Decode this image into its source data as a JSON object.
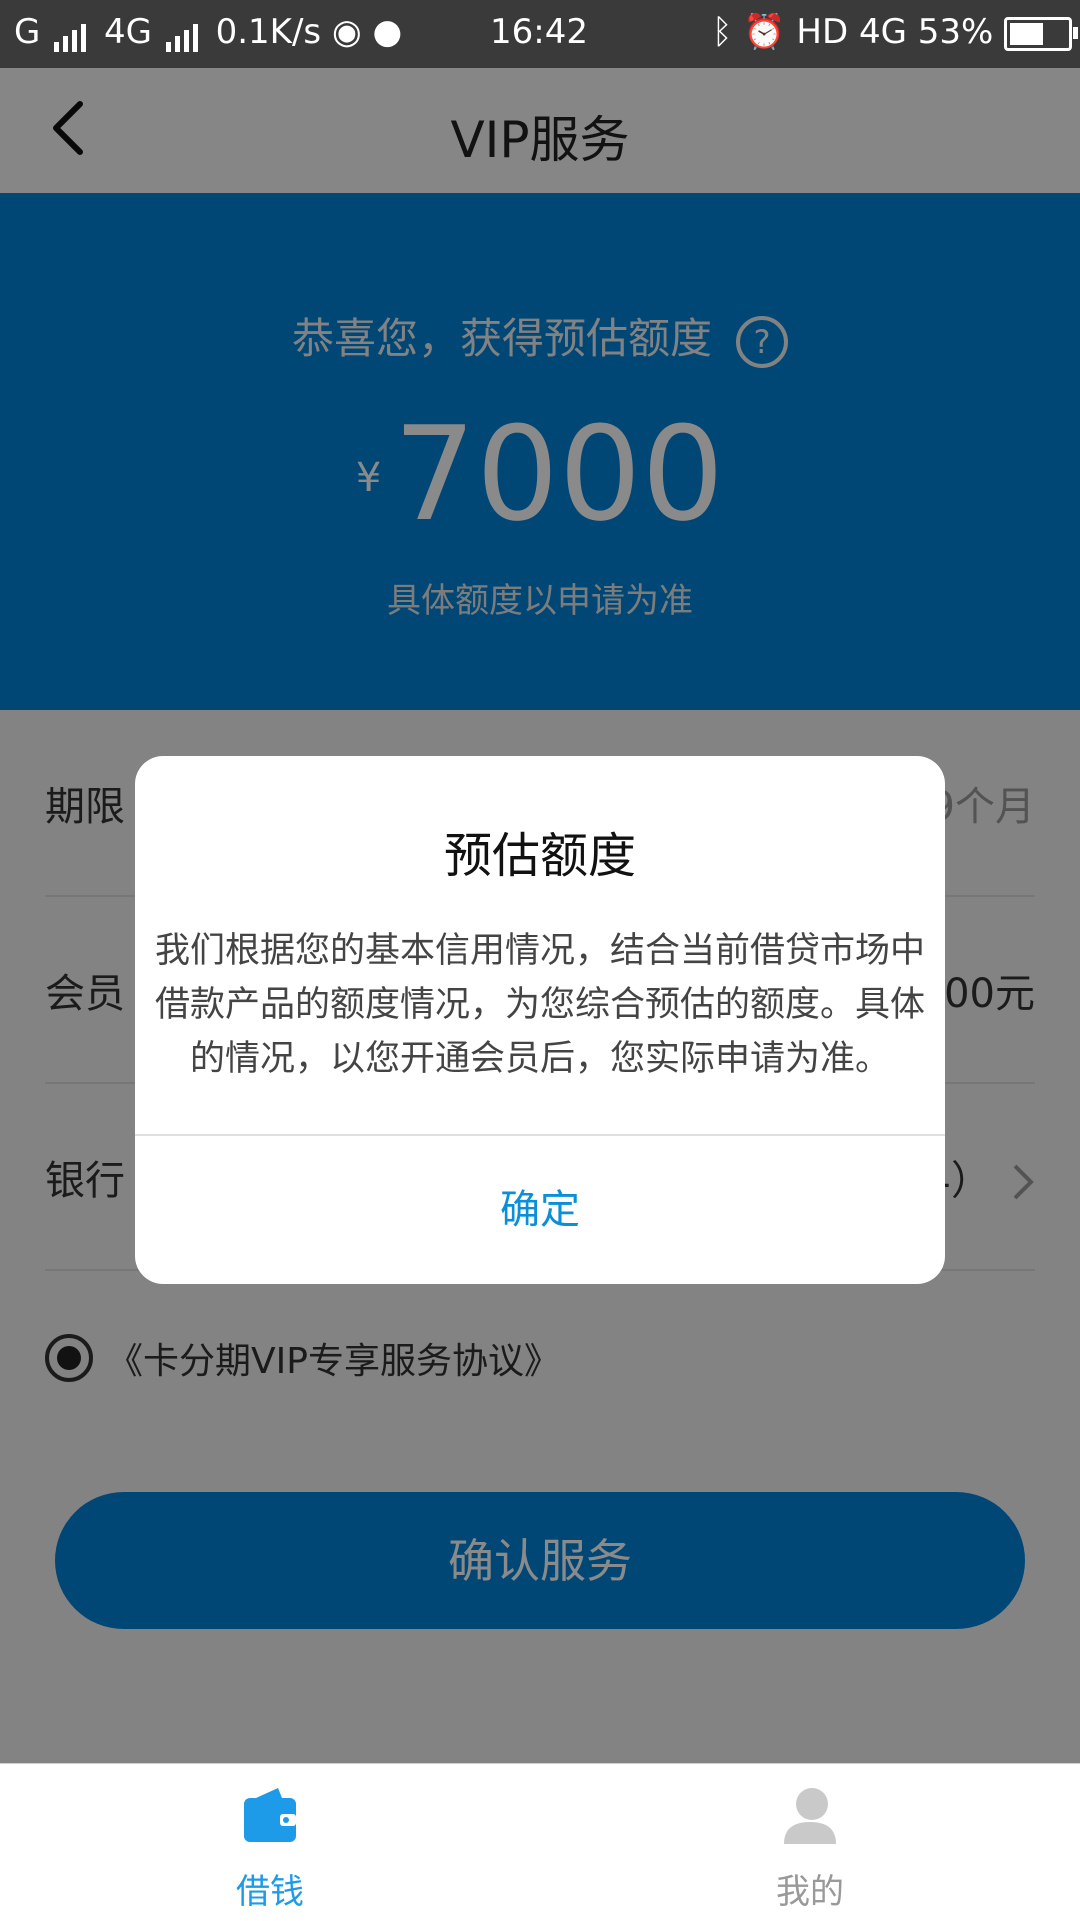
{
  "status_bar": {
    "carrier1": "G",
    "carrier2": "4G",
    "speed": "0.1K/s",
    "time": "16:42",
    "hd": "HD",
    "net": "4G",
    "battery_pct": "53%",
    "battery_level": 0.53
  },
  "nav": {
    "title": "VIP服务",
    "back_icon": "chevron-left-icon"
  },
  "hero": {
    "title": "恭喜您，获得预估额度",
    "help_icon_text": "?",
    "currency": "¥",
    "amount": "7000",
    "subtitle": "具体额度以申请为准"
  },
  "form": {
    "rows": [
      {
        "label": "期限",
        "value": "9个月"
      },
      {
        "label": "会员",
        "value": "00元"
      },
      {
        "label": "银行",
        "value": "4）"
      }
    ],
    "agreement": "《卡分期VIP专享服务协议》",
    "confirm_button": "确认服务"
  },
  "dialog": {
    "title": "预估额度",
    "body": "我们根据您的基本信用情况，结合当前借贷市场中借款产品的额度情况，为您综合预估的额度。具体的情况，以您开通会员后，您实际申请为准。",
    "ok_button": "确定"
  },
  "tabbar": {
    "tabs": [
      {
        "label": "借钱",
        "icon": "wallet-icon",
        "active": true
      },
      {
        "label": "我的",
        "icon": "user-icon",
        "active": false
      }
    ],
    "active_color": "#1e9be8",
    "inactive_color": "#999999"
  },
  "colors": {
    "brand_blue": "#0084d8",
    "dialog_button": "#0a8fd8"
  }
}
